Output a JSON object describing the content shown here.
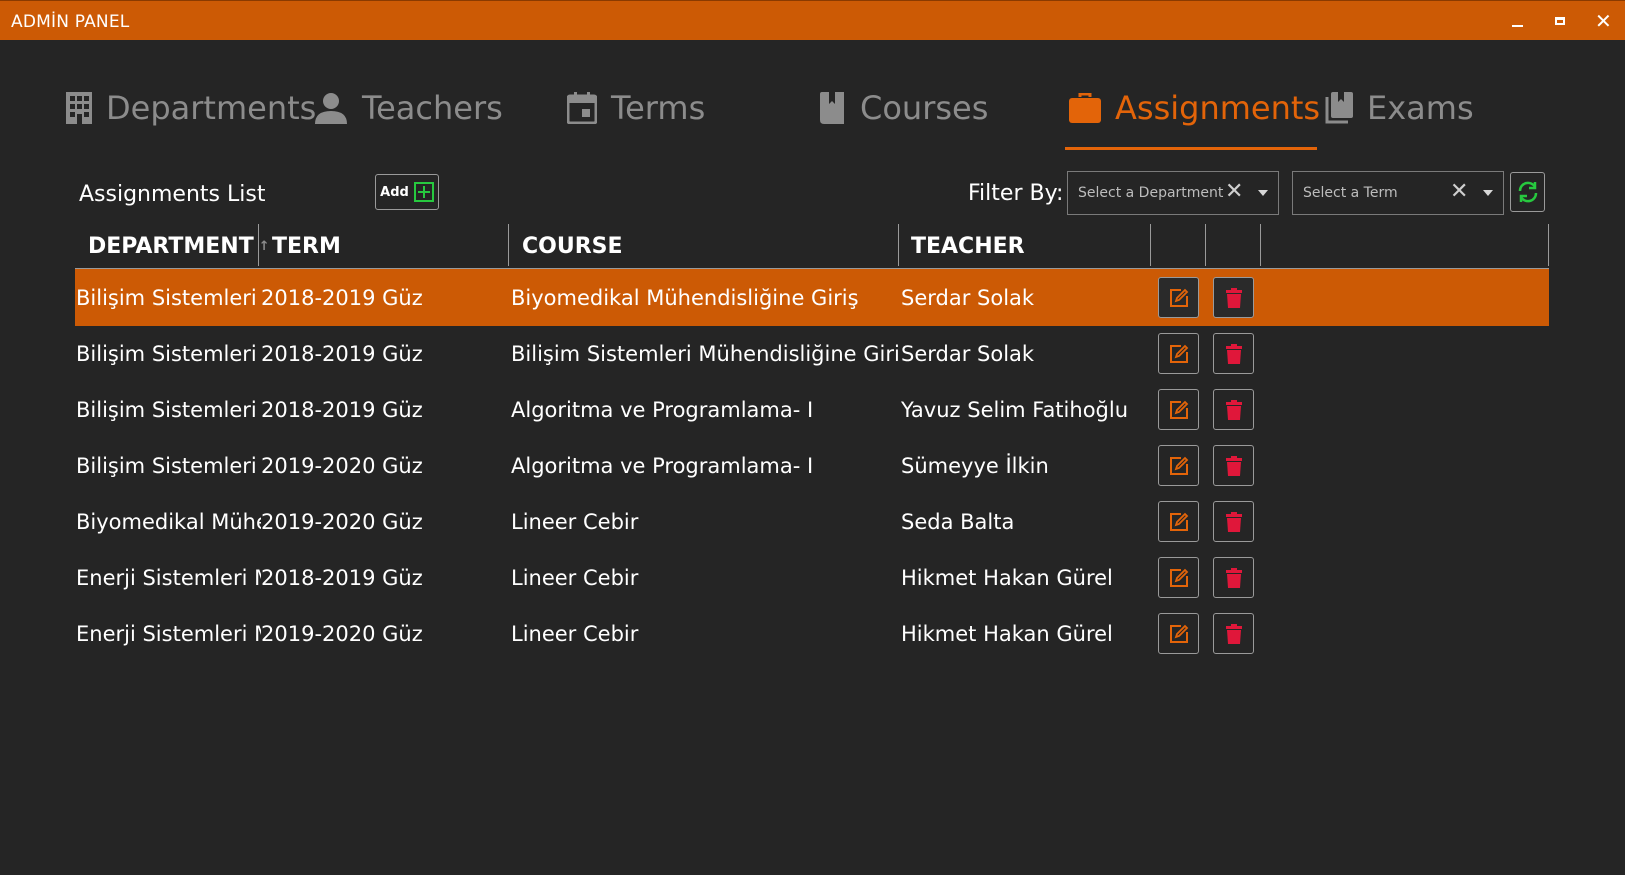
{
  "window": {
    "title": "ADMİN PANEL",
    "accent": "#CC5A05"
  },
  "tabs": [
    {
      "label": "Departments",
      "icon": "building-icon",
      "active": false
    },
    {
      "label": "Teachers",
      "icon": "user-icon",
      "active": false
    },
    {
      "label": "Terms",
      "icon": "calendar-icon",
      "active": false
    },
    {
      "label": "Courses",
      "icon": "book-icon",
      "active": false
    },
    {
      "label": "Assignments",
      "icon": "briefcase-icon",
      "active": true
    },
    {
      "label": "Exams",
      "icon": "books-icon",
      "active": false
    }
  ],
  "toolbar": {
    "list_title": "Assignments List",
    "add_label": "Add",
    "filter_label": "Filter By:",
    "department_placeholder": "Select a Department",
    "term_placeholder": "Select a Term"
  },
  "table": {
    "columns": [
      "DEPARTMENT",
      "TERM",
      "COURSE",
      "TEACHER"
    ],
    "rows": [
      {
        "department": "Bilişim Sistemleri M",
        "term": "2018-2019 Güz",
        "course": "Biyomedikal Mühendisliğine Giriş",
        "teacher": "Serdar Solak",
        "selected": true
      },
      {
        "department": "Bilişim Sistemleri M",
        "term": "2018-2019 Güz",
        "course": "Bilişim Sistemleri Mühendisliğine Giriş",
        "teacher": "Serdar Solak",
        "selected": false
      },
      {
        "department": "Bilişim Sistemleri M",
        "term": "2018-2019 Güz",
        "course": "Algoritma ve Programlama- I",
        "teacher": "Yavuz Selim Fatihoğlu",
        "selected": false
      },
      {
        "department": "Bilişim Sistemleri M",
        "term": "2019-2020 Güz",
        "course": "Algoritma ve Programlama- I",
        "teacher": "Sümeyye İlkin",
        "selected": false
      },
      {
        "department": "Biyomedikal Mühendisliği",
        "term": "2019-2020 Güz",
        "course": "Lineer Cebir",
        "teacher": "Seda Balta",
        "selected": false
      },
      {
        "department": "Enerji Sistemleri Mühendisliği",
        "term": "2018-2019 Güz",
        "course": "Lineer Cebir",
        "teacher": "Hikmet Hakan Gürel",
        "selected": false
      },
      {
        "department": "Enerji Sistemleri Mühendisliği",
        "term": "2019-2020 Güz",
        "course": "Lineer Cebir",
        "teacher": "Hikmet Hakan Gürel",
        "selected": false
      }
    ]
  },
  "colors": {
    "background": "#252525",
    "accent": "#E36409",
    "delete": "#E0173A",
    "refresh": "#27C93F",
    "add": "#27C93F"
  }
}
